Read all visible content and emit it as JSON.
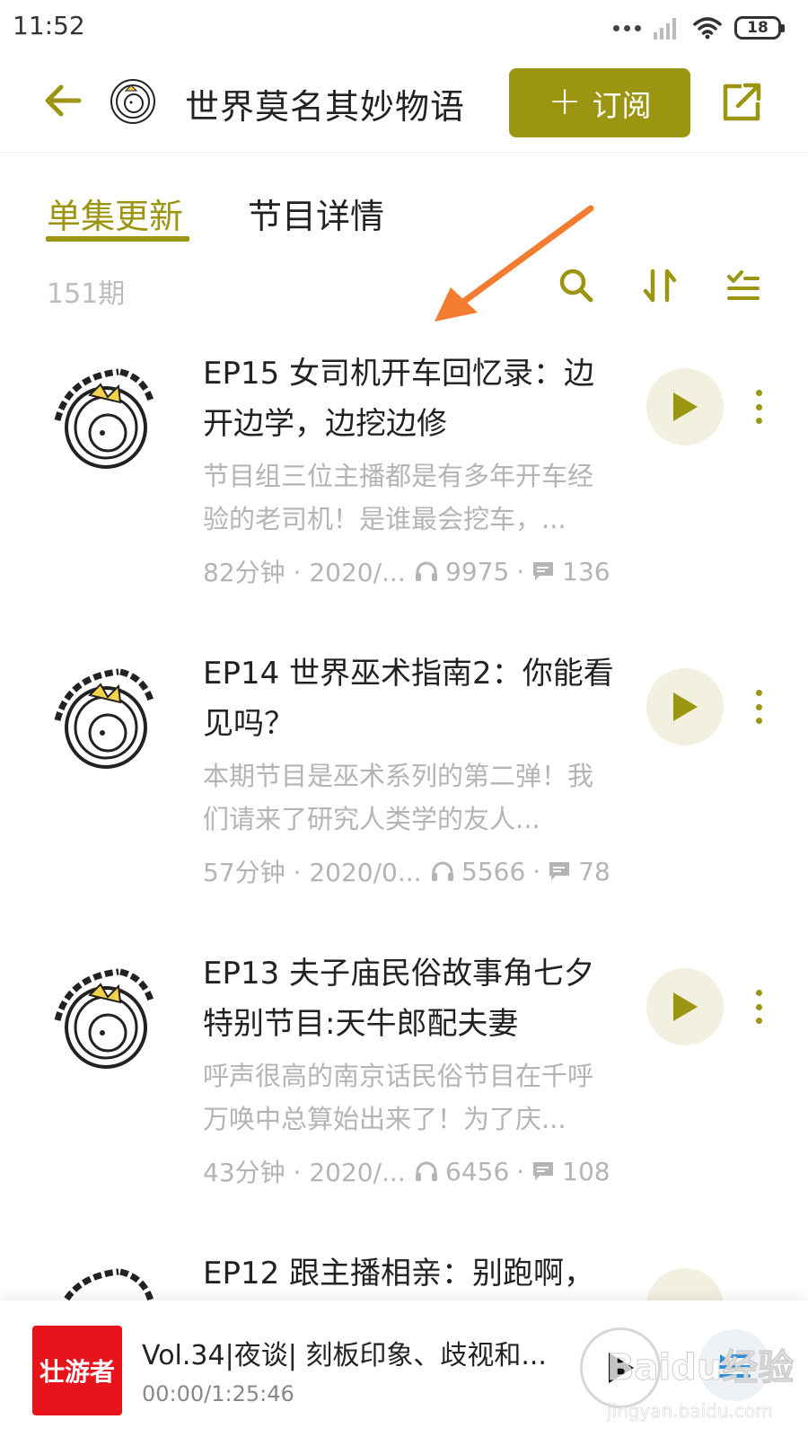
{
  "status_bar": {
    "time": "11:52",
    "battery": "18",
    "icons": [
      "more-dots-icon",
      "signal-icon",
      "wifi-icon",
      "battery-icon"
    ]
  },
  "header": {
    "podcast_title": "世界莫名其妙物语",
    "subscribe_label": "订阅",
    "icons": [
      "back-arrow-icon",
      "podcast-logo",
      "plus-icon",
      "share-icon"
    ]
  },
  "tabs": [
    {
      "label": "单集更新",
      "active": true
    },
    {
      "label": "节目详情",
      "active": false
    }
  ],
  "list_toolbar": {
    "episode_count": "151期",
    "icons": [
      "search-icon",
      "sort-icon",
      "filter-list-icon"
    ]
  },
  "episodes": [
    {
      "title": "EP15 女司机开车回忆录：边开边学，边挖边修",
      "description": "节目组三位主播都是有多年开车经验的老司机！是谁最会挖车，...",
      "duration_date": "82分钟 · 2020/...",
      "plays": "9975",
      "comments": "136"
    },
    {
      "title": "EP14 世界巫术指南2：你能看见吗？",
      "description": "本期节目是巫术系列的第二弹！我们请来了研究人类学的友人...",
      "duration_date": "57分钟 · 2020/0...",
      "plays": "5566",
      "comments": "78"
    },
    {
      "title": "EP13 夫子庙民俗故事角七夕特别节目:天牛郎配夫妻",
      "description": "呼声很高的南京话民俗节目在千呼万唤中总算始出来了！为了庆...",
      "duration_date": "43分钟 · 2020/...",
      "plays": "6456",
      "comments": "108"
    },
    {
      "title": "EP12 跟主播相亲：别跑啊，",
      "description": "",
      "duration_date": "",
      "plays": "",
      "comments": ""
    }
  ],
  "mini_player": {
    "cover_text": "壮游者",
    "title": "Vol.34|夜谈| 刻板印象、歧视和...",
    "time": "00:00/1:25:46"
  },
  "watermark": {
    "text": "Baidu经验",
    "subtext": "jingyan.baidu.com"
  },
  "colors": {
    "accent": "#9b9512",
    "muted_text": "#b4b4b4",
    "play_bg": "#f2f1e0",
    "annotation": "#f47c30",
    "mini_cover": "#e8141b"
  }
}
